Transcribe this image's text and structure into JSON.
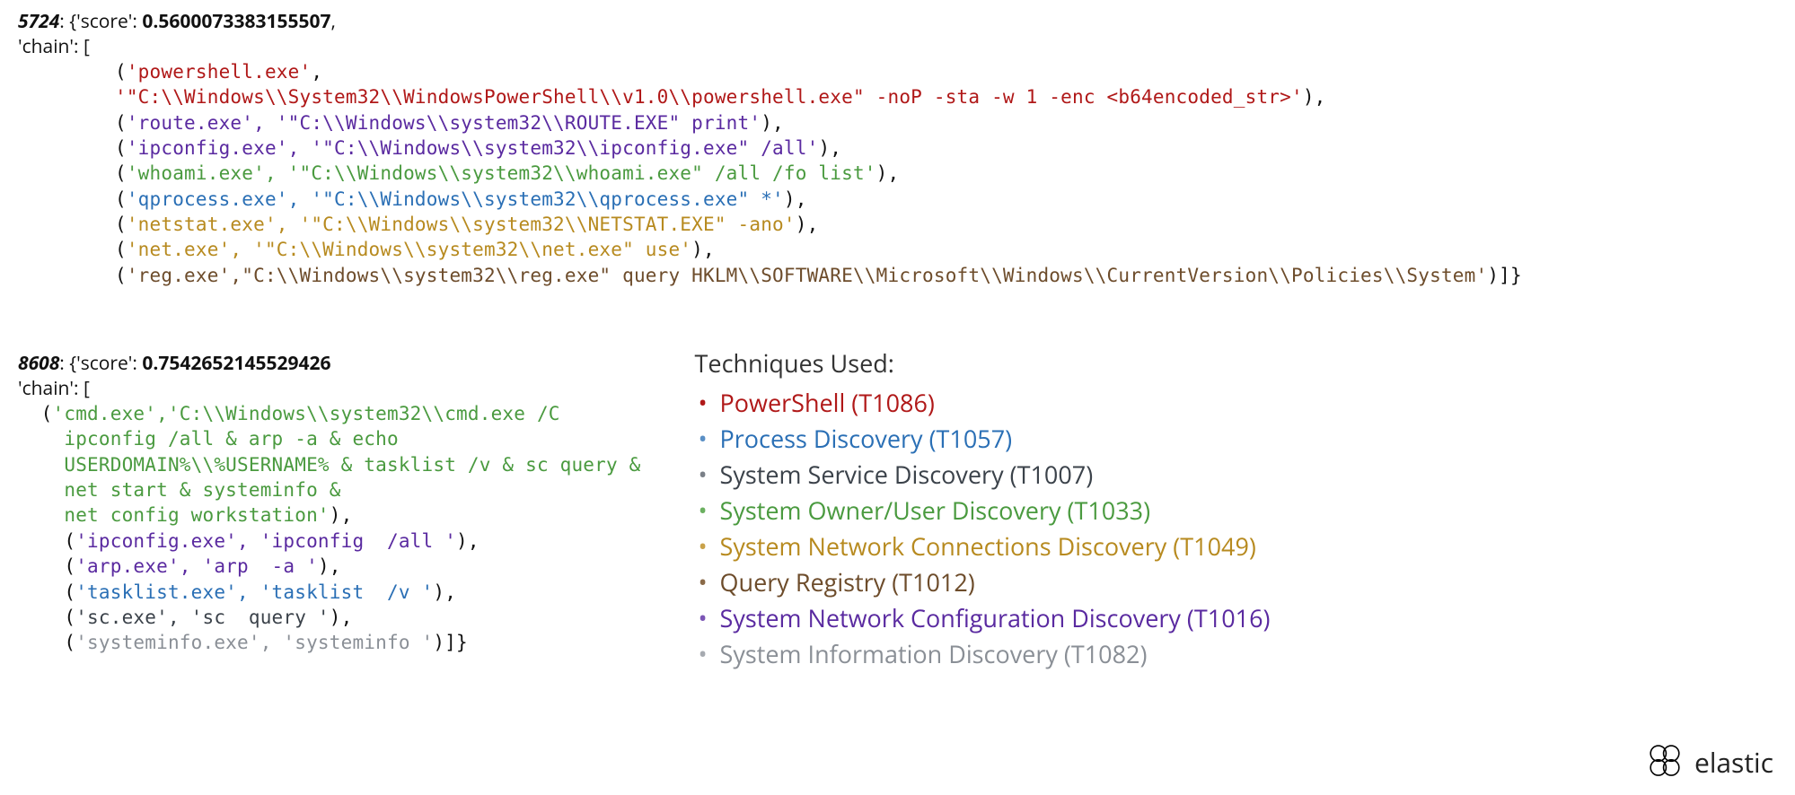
{
  "block1": {
    "id": "5724",
    "score_label": "{'score': ",
    "score": "0.5600073383155507",
    "score_trail": ",",
    "chain_label": " 'chain': [",
    "lines": [
      {
        "segs": [
          {
            "t": "(",
            "c": "c-black"
          },
          {
            "t": "'powershell.exe'",
            "c": "c-red"
          },
          {
            "t": ",",
            "c": "c-black"
          }
        ]
      },
      {
        "segs": [
          {
            "t": "'\"C:\\\\Windows\\\\System32\\\\WindowsPowerShell\\\\v1.0\\\\powershell.exe\" -noP -sta -w 1 -enc <b64encoded_str>'",
            "c": "c-red"
          },
          {
            "t": "),",
            "c": "c-black"
          }
        ]
      },
      {
        "segs": [
          {
            "t": "(",
            "c": "c-black"
          },
          {
            "t": "'route.exe', '\"C:\\\\Windows\\\\system32\\\\ROUTE.EXE\" print'",
            "c": "c-purple"
          },
          {
            "t": "),",
            "c": "c-black"
          }
        ]
      },
      {
        "segs": [
          {
            "t": "(",
            "c": "c-black"
          },
          {
            "t": "'ipconfig.exe', '\"C:\\\\Windows\\\\system32\\\\ipconfig.exe\" /all'",
            "c": "c-purple"
          },
          {
            "t": "),",
            "c": "c-black"
          }
        ]
      },
      {
        "segs": [
          {
            "t": "(",
            "c": "c-black"
          },
          {
            "t": "'whoami.exe', '\"C:\\\\Windows\\\\system32\\\\whoami.exe\" /all /fo list'",
            "c": "c-green"
          },
          {
            "t": "),",
            "c": "c-black"
          }
        ]
      },
      {
        "segs": [
          {
            "t": "(",
            "c": "c-black"
          },
          {
            "t": "'qprocess.exe', '\"C:\\\\Windows\\\\system32\\\\qprocess.exe\" *'",
            "c": "c-blue"
          },
          {
            "t": "),",
            "c": "c-black"
          }
        ]
      },
      {
        "segs": [
          {
            "t": "(",
            "c": "c-black"
          },
          {
            "t": "'netstat.exe', '\"C:\\\\Windows\\\\system32\\\\NETSTAT.EXE\" -ano'",
            "c": "c-gold"
          },
          {
            "t": "),",
            "c": "c-black"
          }
        ]
      },
      {
        "segs": [
          {
            "t": "(",
            "c": "c-black"
          },
          {
            "t": "'net.exe', '\"C:\\\\Windows\\\\system32\\\\net.exe\" use'",
            "c": "c-gold"
          },
          {
            "t": "),",
            "c": "c-black"
          }
        ]
      },
      {
        "segs": [
          {
            "t": "(",
            "c": "c-black"
          },
          {
            "t": "'reg.exe',\"C:\\\\Windows\\\\system32\\\\reg.exe\" query HKLM\\\\SOFTWARE\\\\Microsoft\\\\Windows\\\\CurrentVersion\\\\Policies\\\\System'",
            "c": "c-brown"
          },
          {
            "t": ")]}",
            "c": "c-black"
          }
        ]
      }
    ]
  },
  "block2": {
    "id": "8608",
    "score_label": "{'score': ",
    "score": "0.7542652145529426",
    "chain_label": " 'chain': [",
    "lines": [
      {
        "segs": [
          {
            "t": "  (",
            "c": "c-black"
          },
          {
            "t": "'cmd.exe','C:\\\\Windows\\\\system32\\\\cmd.exe /C",
            "c": "c-green"
          }
        ]
      },
      {
        "segs": [
          {
            "t": "    ipconfig /all & arp -a & echo",
            "c": "c-green"
          }
        ]
      },
      {
        "segs": [
          {
            "t": "    USERDOMAIN%\\\\%USERNAME% & tasklist /v & sc query &",
            "c": "c-green"
          }
        ]
      },
      {
        "segs": [
          {
            "t": "    net start & systeminfo &",
            "c": "c-green"
          }
        ]
      },
      {
        "segs": [
          {
            "t": "    net config workstation'",
            "c": "c-green"
          },
          {
            "t": "),",
            "c": "c-black"
          }
        ]
      },
      {
        "segs": [
          {
            "t": "    (",
            "c": "c-black"
          },
          {
            "t": "'ipconfig.exe', 'ipconfig  /all '",
            "c": "c-purple"
          },
          {
            "t": "),",
            "c": "c-black"
          }
        ]
      },
      {
        "segs": [
          {
            "t": "    (",
            "c": "c-black"
          },
          {
            "t": "'arp.exe', 'arp  -a '",
            "c": "c-purple"
          },
          {
            "t": "),",
            "c": "c-black"
          }
        ]
      },
      {
        "segs": [
          {
            "t": "    (",
            "c": "c-black"
          },
          {
            "t": "'tasklist.exe', 'tasklist  /v '",
            "c": "c-blue"
          },
          {
            "t": "),",
            "c": "c-black"
          }
        ]
      },
      {
        "segs": [
          {
            "t": "    (",
            "c": "c-black"
          },
          {
            "t": "'sc.exe', 'sc  query '",
            "c": "c-dgray"
          },
          {
            "t": "),",
            "c": "c-black"
          }
        ]
      },
      {
        "segs": [
          {
            "t": "    (",
            "c": "c-black"
          },
          {
            "t": "'systeminfo.exe', 'systeminfo '",
            "c": "c-gray"
          },
          {
            "t": ")]}",
            "c": "c-black"
          }
        ]
      }
    ]
  },
  "legend": {
    "title": "Techniques Used:",
    "items": [
      {
        "label": "PowerShell (T1086)",
        "c": "c-red"
      },
      {
        "label": "Process Discovery (T1057)",
        "c": "c-blue"
      },
      {
        "label": "System Service Discovery (T1007)",
        "c": "c-dgray"
      },
      {
        "label": "System Owner/User Discovery (T1033)",
        "c": "c-green"
      },
      {
        "label": "System Network Connections Discovery (T1049)",
        "c": "c-gold"
      },
      {
        "label": "Query Registry (T1012)",
        "c": "c-brown"
      },
      {
        "label": "System Network Configuration Discovery (T1016)",
        "c": "c-purple"
      },
      {
        "label": "System Information Discovery (T1082)",
        "c": "c-gray"
      }
    ]
  },
  "logo_text": "elastic"
}
